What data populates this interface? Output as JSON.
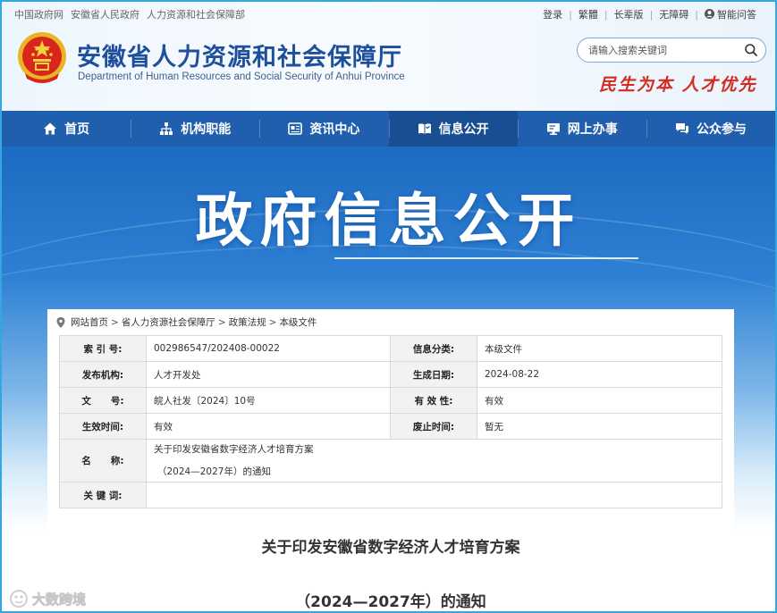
{
  "toplinks_left": [
    "中国政府网",
    "安徽省人民政府",
    "人力资源和社会保障部"
  ],
  "toplinks_right": {
    "login": "登录",
    "traditional": "繁體",
    "elder": "长辈版",
    "accessible": "无障碍",
    "qa": "智能问答"
  },
  "site": {
    "title": "安徽省人力资源和社会保障厅",
    "subtitle": "Department of Human Resources and Social Security of Anhui Province",
    "slogan": "民生为本  人才优先"
  },
  "search": {
    "placeholder": "请输入搜索关键词"
  },
  "nav": [
    {
      "label": "首页",
      "icon": "home-icon"
    },
    {
      "label": "机构职能",
      "icon": "org-chart-icon"
    },
    {
      "label": "资讯中心",
      "icon": "news-icon"
    },
    {
      "label": "信息公开",
      "icon": "open-book-icon",
      "active": true
    },
    {
      "label": "网上办事",
      "icon": "monitor-icon"
    },
    {
      "label": "公众参与",
      "icon": "chat-icon"
    }
  ],
  "banner": {
    "title": "政府信息公开"
  },
  "breadcrumb": [
    "网站首页",
    "省人力资源社会保障厅",
    "政策法规",
    "本级文件"
  ],
  "meta": {
    "index_label": "索 引 号:",
    "index_value": "002986547/202408-00022",
    "category_label": "信息分类:",
    "category_value": "本级文件",
    "issuer_label": "发布机构:",
    "issuer_value": "人才开发处",
    "date_label": "生成日期:",
    "date_value": "2024-08-22",
    "docno_label": "文      号:",
    "docno_value": "皖人社发〔2024〕10号",
    "validity_label": "有 效 性:",
    "validity_value": "有效",
    "effective_label": "生效时间:",
    "effective_value": "有效",
    "expire_label": "废止时间:",
    "expire_value": "暂无",
    "name_label": "名      称:",
    "name_value_1": "关于印发安徽省数字经济人才培育方案",
    "name_value_2": "（2024—2027年）的通知",
    "keywords_label": "关 键 词:",
    "keywords_value": ""
  },
  "document": {
    "title_line1": "关于印发安徽省数字经济人才培育方案",
    "title_line2": "（2024—2027年）的通知"
  },
  "watermark": {
    "text": "大数跨境"
  },
  "colors": {
    "nav_bg": "#1f5fae",
    "title_blue": "#1e4f9c",
    "slogan_red": "#d42a1f",
    "frame_border": "#35a7e0"
  }
}
